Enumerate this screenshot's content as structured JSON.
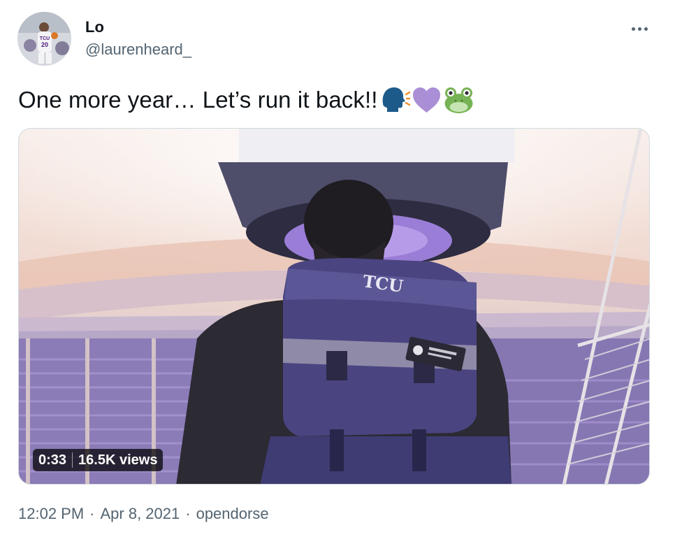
{
  "author": {
    "display_name": "Lo",
    "handle": "@laurenheard_",
    "avatar_jersey_text": "TCU",
    "avatar_jersey_number": "20"
  },
  "tweet": {
    "text": "One more year… Let’s run it back!!",
    "emojis": [
      "speaking-head-icon",
      "purple-heart-icon",
      "frog-face-icon"
    ]
  },
  "media": {
    "type": "video",
    "duration": "0:33",
    "views": "16.5K views",
    "backpack_text": "TCU"
  },
  "meta": {
    "time": "12:02 PM",
    "date": "Apr 8, 2021",
    "source": "opendorse",
    "separator": "·"
  },
  "colors": {
    "text_primary": "#0f1419",
    "text_secondary": "#536471",
    "border": "#cfd9de",
    "tcu_purple": "#4d1979"
  }
}
